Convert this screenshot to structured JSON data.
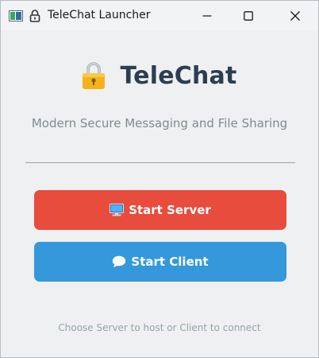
{
  "window": {
    "title": "TeleChat Launcher"
  },
  "icons": {
    "app": "app-window-icon",
    "title_lock": "lock-icon",
    "brand_lock": "lock-icon",
    "server": "computer-icon",
    "client": "speech-bubble-icon",
    "minimize": "minimize-icon",
    "maximize": "maximize-icon",
    "close": "close-icon"
  },
  "main": {
    "brand_title": "TeleChat",
    "subtitle": "Modern Secure Messaging and File Sharing",
    "server_button_label": "Start Server",
    "client_button_label": "Start Client",
    "hint": "Choose Server to host or Client to connect"
  },
  "colors": {
    "server_button": "#e74c3c",
    "client_button": "#3498db",
    "brand_title": "#2c3e50",
    "subtitle": "#7f8c8d",
    "hint": "#95a5a6",
    "background": "#eef0f2"
  }
}
